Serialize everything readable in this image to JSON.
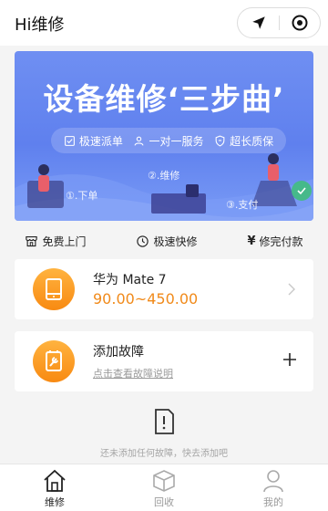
{
  "header": {
    "title": "Hi维修",
    "location_icon": "location-arrow-icon",
    "record_icon": "record-icon"
  },
  "banner": {
    "headline": "设备维修‘三步曲’",
    "features": [
      {
        "icon": "checklist-icon",
        "label": "极速派单"
      },
      {
        "icon": "person-icon",
        "label": "一对一服务"
      },
      {
        "icon": "shield-icon",
        "label": "超长质保"
      }
    ],
    "steps": [
      "①.下单",
      "②.维修",
      "③.支付"
    ]
  },
  "features": [
    {
      "icon": "shop-icon",
      "label": "免费上门"
    },
    {
      "icon": "clock-icon",
      "label": "极速快修"
    },
    {
      "icon": "yen-icon",
      "label": "修完付款"
    }
  ],
  "device": {
    "name": "华为 Mate 7",
    "price_range": "90.00~450.00"
  },
  "fault": {
    "title": "添加故障",
    "link": "点击查看故障说明"
  },
  "empty_hint": "还未添加任何故障，快去添加吧",
  "tabs": [
    {
      "label": "维修",
      "icon": "house-icon",
      "active": true
    },
    {
      "label": "回收",
      "icon": "box-icon",
      "active": false
    },
    {
      "label": "我的",
      "icon": "user-icon",
      "active": false
    }
  ],
  "colors": {
    "accent": "#f18a1a",
    "banner": "#6f8ff2",
    "check": "#46b98a"
  }
}
